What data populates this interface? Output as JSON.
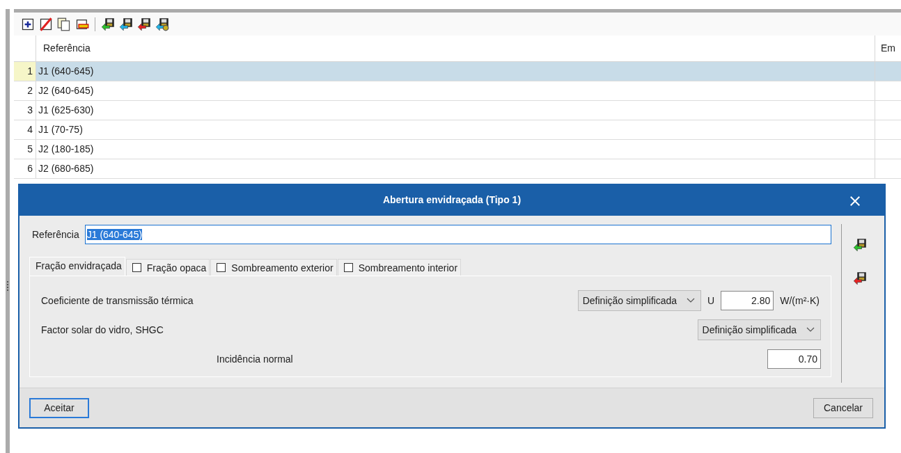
{
  "table": {
    "columns": [
      "Referência",
      "Em"
    ],
    "rows": [
      {
        "number": "1",
        "reference": "J1 (640-645)",
        "selected": true
      },
      {
        "number": "2",
        "reference": "J2 (640-645)",
        "selected": false
      },
      {
        "number": "3",
        "reference": "J1 (625-630)",
        "selected": false
      },
      {
        "number": "4",
        "reference": "J1 (70-75)",
        "selected": false
      },
      {
        "number": "5",
        "reference": "J2 (180-185)",
        "selected": false
      },
      {
        "number": "6",
        "reference": "J2 (680-685)",
        "selected": false
      }
    ]
  },
  "dialog": {
    "title": "Abertura envidraçada (Tipo 1)",
    "reference": {
      "label": "Referência",
      "value": "J1 (640-645)",
      "text_selected": true
    },
    "tabs": [
      {
        "label": "Fração envidraçada",
        "kind": "plain",
        "selected": true
      },
      {
        "label": "Fração opaca",
        "kind": "checkbox",
        "checked": false,
        "selected": false
      },
      {
        "label": "Sombreamento exterior",
        "kind": "checkbox",
        "checked": false,
        "selected": false
      },
      {
        "label": "Sombreamento interior",
        "kind": "checkbox",
        "checked": false,
        "selected": false
      }
    ],
    "thermal": {
      "label": "Coeficiente de transmissão térmica",
      "mode": "Definição simplificada",
      "u_label": "U",
      "u_value": "2.80",
      "unit": "W/(m²·K)"
    },
    "solar": {
      "label": "Factor solar do vidro, SHGC",
      "mode": "Definição simplificada"
    },
    "normal": {
      "label": "Incidência normal",
      "value": "0.70"
    },
    "accept": {
      "label": "Aceitar",
      "focused": true
    },
    "cancel": {
      "label": "Cancelar",
      "focused": false
    }
  }
}
